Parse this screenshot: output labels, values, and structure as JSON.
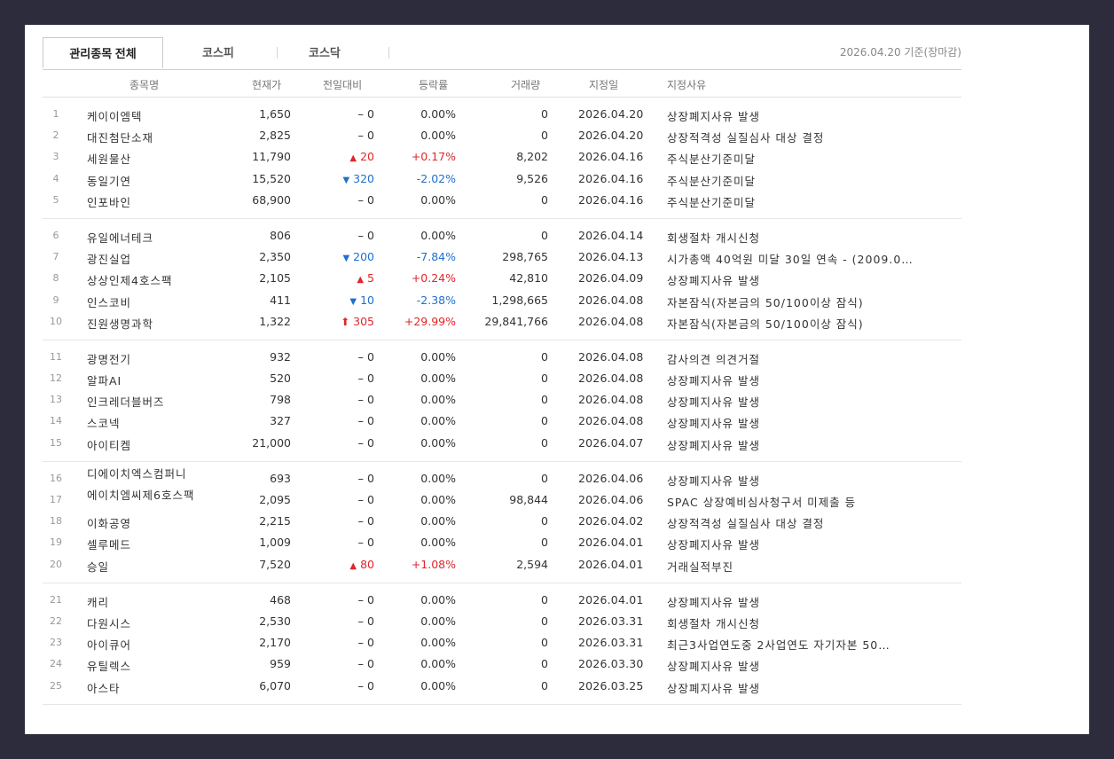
{
  "tabs": [
    {
      "label": "관리종목 전체",
      "active": true
    },
    {
      "label": "코스피",
      "active": false
    },
    {
      "label": "코스닥",
      "active": false
    }
  ],
  "base_date": "2026.04.20 기준(장마감)",
  "columns": [
    "종목명",
    "현재가",
    "전일대비",
    "등락률",
    "거래량",
    "지정일",
    "지정사유"
  ],
  "colors": {
    "up": "#e0262a",
    "down": "#1f6fcf",
    "neutral": "#333333"
  },
  "groups": [
    [
      {
        "no": "1",
        "name": "케이이엠텍",
        "price": "1,650",
        "dir": "flat",
        "chg": "0",
        "rate": "0.00%",
        "vol": "0",
        "date": "2026.04.20",
        "reason": "상장폐지사유 발생"
      },
      {
        "no": "2",
        "name": "대진첨단소재",
        "price": "2,825",
        "dir": "flat",
        "chg": "0",
        "rate": "0.00%",
        "vol": "0",
        "date": "2026.04.20",
        "reason": "상장적격성 실질심사 대상 결정"
      },
      {
        "no": "3",
        "name": "세원물산",
        "price": "11,790",
        "dir": "up",
        "chg": "20",
        "rate": "+0.17%",
        "vol": "8,202",
        "date": "2026.04.16",
        "reason": "주식분산기준미달"
      },
      {
        "no": "4",
        "name": "동일기연",
        "price": "15,520",
        "dir": "down",
        "chg": "320",
        "rate": "-2.02%",
        "vol": "9,526",
        "date": "2026.04.16",
        "reason": "주식분산기준미달"
      },
      {
        "no": "5",
        "name": "인포바인",
        "price": "68,900",
        "dir": "flat",
        "chg": "0",
        "rate": "0.00%",
        "vol": "0",
        "date": "2026.04.16",
        "reason": "주식분산기준미달"
      }
    ],
    [
      {
        "no": "6",
        "name": "유일에너테크",
        "price": "806",
        "dir": "flat",
        "chg": "0",
        "rate": "0.00%",
        "vol": "0",
        "date": "2026.04.14",
        "reason": "회생절차 개시신청"
      },
      {
        "no": "7",
        "name": "광진실업",
        "price": "2,350",
        "dir": "down",
        "chg": "200",
        "rate": "-7.84%",
        "vol": "298,765",
        "date": "2026.04.13",
        "reason": "시가총액 40억원 미달 30일 연속 - (2009.0…"
      },
      {
        "no": "8",
        "name": "상상인제4호스팩",
        "price": "2,105",
        "dir": "up",
        "chg": "5",
        "rate": "+0.24%",
        "vol": "42,810",
        "date": "2026.04.09",
        "reason": "상장폐지사유 발생"
      },
      {
        "no": "9",
        "name": "인스코비",
        "price": "411",
        "dir": "down",
        "chg": "10",
        "rate": "-2.38%",
        "vol": "1,298,665",
        "date": "2026.04.08",
        "reason": "자본잠식(자본금의 50/100이상 잠식)"
      },
      {
        "no": "10",
        "name": "진원생명과학",
        "price": "1,322",
        "dir": "limitup",
        "chg": "305",
        "rate": "+29.99%",
        "vol": "29,841,766",
        "date": "2026.04.08",
        "reason": "자본잠식(자본금의 50/100이상 잠식)"
      }
    ],
    [
      {
        "no": "11",
        "name": "광명전기",
        "price": "932",
        "dir": "flat",
        "chg": "0",
        "rate": "0.00%",
        "vol": "0",
        "date": "2026.04.08",
        "reason": "감사의견 의견거절"
      },
      {
        "no": "12",
        "name": "알파AI",
        "price": "520",
        "dir": "flat",
        "chg": "0",
        "rate": "0.00%",
        "vol": "0",
        "date": "2026.04.08",
        "reason": "상장폐지사유 발생"
      },
      {
        "no": "13",
        "name": "인크레더블버즈",
        "price": "798",
        "dir": "flat",
        "chg": "0",
        "rate": "0.00%",
        "vol": "0",
        "date": "2026.04.08",
        "reason": "상장폐지사유 발생"
      },
      {
        "no": "14",
        "name": "스코넥",
        "price": "327",
        "dir": "flat",
        "chg": "0",
        "rate": "0.00%",
        "vol": "0",
        "date": "2026.04.08",
        "reason": "상장폐지사유 발생"
      },
      {
        "no": "15",
        "name": "아이티켐",
        "price": "21,000",
        "dir": "flat",
        "chg": "0",
        "rate": "0.00%",
        "vol": "0",
        "date": "2026.04.07",
        "reason": "상장폐지사유 발생"
      }
    ],
    [
      {
        "no": "16",
        "name": "디에이치엑스컴퍼니",
        "price": "693",
        "dir": "flat",
        "chg": "0",
        "rate": "0.00%",
        "vol": "0",
        "date": "2026.04.06",
        "reason": "상장폐지사유 발생",
        "wrap": true
      },
      {
        "no": "17",
        "name": "에이치엠씨제6호스팩",
        "price": "2,095",
        "dir": "flat",
        "chg": "0",
        "rate": "0.00%",
        "vol": "98,844",
        "date": "2026.04.06",
        "reason": "SPAC 상장예비심사청구서 미제출 등",
        "wrap": true
      },
      {
        "no": "18",
        "name": "이화공영",
        "price": "2,215",
        "dir": "flat",
        "chg": "0",
        "rate": "0.00%",
        "vol": "0",
        "date": "2026.04.02",
        "reason": "상장적격성 실질심사 대상 결정"
      },
      {
        "no": "19",
        "name": "셀루메드",
        "price": "1,009",
        "dir": "flat",
        "chg": "0",
        "rate": "0.00%",
        "vol": "0",
        "date": "2026.04.01",
        "reason": "상장폐지사유 발생"
      },
      {
        "no": "20",
        "name": "승일",
        "price": "7,520",
        "dir": "up",
        "chg": "80",
        "rate": "+1.08%",
        "vol": "2,594",
        "date": "2026.04.01",
        "reason": "거래실적부진"
      }
    ],
    [
      {
        "no": "21",
        "name": "캐리",
        "price": "468",
        "dir": "flat",
        "chg": "0",
        "rate": "0.00%",
        "vol": "0",
        "date": "2026.04.01",
        "reason": "상장폐지사유 발생"
      },
      {
        "no": "22",
        "name": "다원시스",
        "price": "2,530",
        "dir": "flat",
        "chg": "0",
        "rate": "0.00%",
        "vol": "0",
        "date": "2026.03.31",
        "reason": "회생절차 개시신청"
      },
      {
        "no": "23",
        "name": "아이큐어",
        "price": "2,170",
        "dir": "flat",
        "chg": "0",
        "rate": "0.00%",
        "vol": "0",
        "date": "2026.03.31",
        "reason": "최근3사업연도중 2사업연도 자기자본 50…"
      },
      {
        "no": "24",
        "name": "유틸렉스",
        "price": "959",
        "dir": "flat",
        "chg": "0",
        "rate": "0.00%",
        "vol": "0",
        "date": "2026.03.30",
        "reason": "상장폐지사유 발생"
      },
      {
        "no": "25",
        "name": "아스타",
        "price": "6,070",
        "dir": "flat",
        "chg": "0",
        "rate": "0.00%",
        "vol": "0",
        "date": "2026.03.25",
        "reason": "상장폐지사유 발생"
      }
    ]
  ]
}
